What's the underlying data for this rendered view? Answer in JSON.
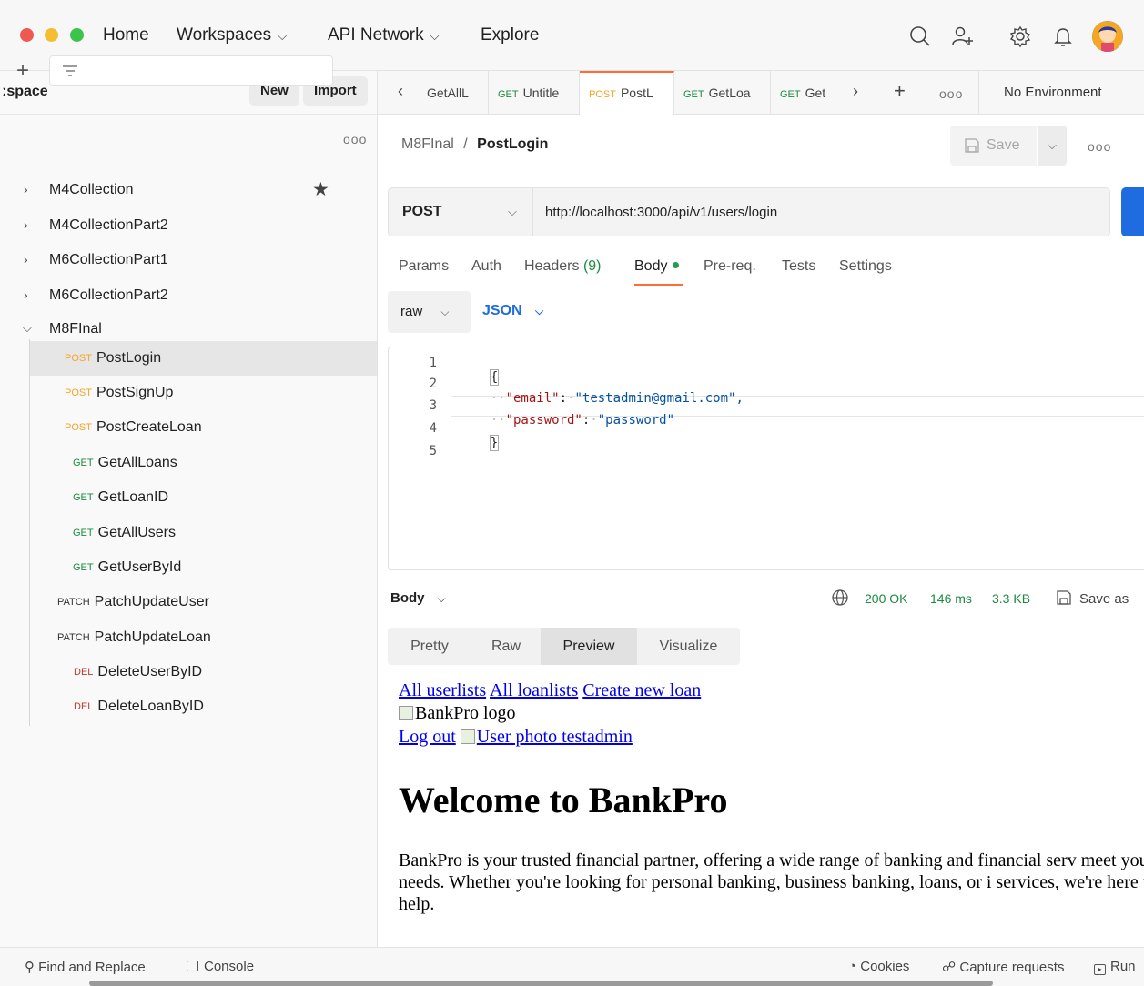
{
  "nav": {
    "home": "Home",
    "workspaces": "Workspaces",
    "api_network": "API Network",
    "explore": "Explore"
  },
  "colors": {
    "accent": "#ff6c37",
    "primary_blue": "#1f6ce0",
    "success_green": "#1d8a3e",
    "post": "#f5a425",
    "delete": "#c0382c"
  },
  "sidebar": {
    "workspace_title": "ːspace",
    "new_label": "New",
    "import_label": "Import",
    "more": "ooo",
    "collections": [
      {
        "label": "M4Collection",
        "starred": true
      },
      {
        "label": "M4CollectionPart2"
      },
      {
        "label": "M6CollectionPart1"
      },
      {
        "label": "M6CollectionPart2"
      },
      {
        "label": "M8FInal",
        "expanded": true
      }
    ],
    "requests": [
      {
        "method": "POST",
        "name": "PostLogin",
        "active": true
      },
      {
        "method": "POST",
        "name": "PostSignUp"
      },
      {
        "method": "POST",
        "name": "PostCreateLoan"
      },
      {
        "method": "GET",
        "name": "GetAllLoans"
      },
      {
        "method": "GET",
        "name": "GetLoanID"
      },
      {
        "method": "GET",
        "name": "GetAllUsers"
      },
      {
        "method": "GET",
        "name": "GetUserById"
      },
      {
        "method": "PATCH",
        "name": "PatchUpdateUser"
      },
      {
        "method": "PATCH",
        "name": "PatchUpdateLoan"
      },
      {
        "method": "DEL",
        "name": "DeleteUserByID"
      },
      {
        "method": "DEL",
        "name": "DeleteLoanByID"
      }
    ]
  },
  "tabs": {
    "items": [
      {
        "method": "",
        "name": "GetAllL"
      },
      {
        "method": "GET",
        "name": "Untitle"
      },
      {
        "method": "POST",
        "name": "PostL",
        "active": true
      },
      {
        "method": "GET",
        "name": "GetLoa"
      },
      {
        "method": "GET",
        "name": "Get"
      }
    ],
    "more": "ooo",
    "environment": "No Environment"
  },
  "request": {
    "breadcrumb_collection": "M8FInal",
    "breadcrumb_separator": "/",
    "breadcrumb_name": "PostLogin",
    "save_label": "Save",
    "more": "ooo",
    "method": "POST",
    "url": "http://localhost:3000/api/v1/users/login",
    "subtabs": {
      "params": "Params",
      "auth": "Auth",
      "headers": "Headers",
      "headers_count": "(9)",
      "body": "Body",
      "prereq": "Pre-req.",
      "tests": "Tests",
      "settings": "Settings"
    },
    "body_mode": "raw",
    "body_format": "JSON",
    "code_lines": [
      {
        "n": "1",
        "text": "{"
      },
      {
        "n": "2",
        "key": "\"email\"",
        "value": "\"testadmin@gmail.com\","
      },
      {
        "n": "3",
        "key": "\"password\"",
        "value": "\"password\""
      },
      {
        "n": "4",
        "text": "}"
      },
      {
        "n": "5",
        "text": ""
      }
    ]
  },
  "response": {
    "body_label": "Body",
    "status": "200 OK",
    "time": "146 ms",
    "size": "3.3 KB",
    "save_as": "Save as",
    "views": [
      "Pretty",
      "Raw",
      "Preview",
      "Visualize"
    ],
    "active_view": "Preview",
    "preview": {
      "links": [
        "All userlists",
        "All loanlists",
        "Create new loan"
      ],
      "logo_alt": "BankPro logo",
      "logout": "Log out",
      "user_photo_alt": "User photo testadmin",
      "heading": "Welcome to BankPro",
      "paragraph": "BankPro is your trusted financial partner, offering a wide range of banking and financial serv meet your needs. Whether you're looking for personal banking, business banking, loans, or i services, we're here to help."
    }
  },
  "statusbar": {
    "find_replace": "Find and Replace",
    "console": "Console",
    "cookies": "Cookies",
    "capture": "Capture requests",
    "runner": "Run"
  }
}
